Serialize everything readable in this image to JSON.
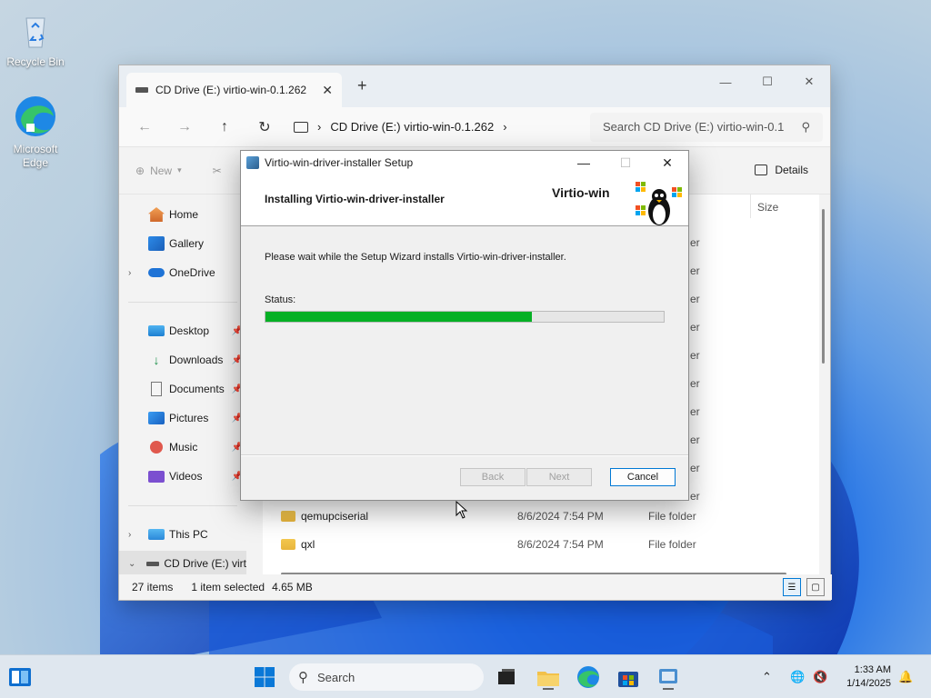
{
  "desktop": {
    "icons": [
      {
        "label": "Recycle Bin"
      },
      {
        "label": "Microsoft Edge"
      }
    ]
  },
  "explorer": {
    "tab_title": "CD Drive (E:) virtio-win-0.1.262",
    "address_path": "CD Drive (E:) virtio-win-0.1.262",
    "search_placeholder": "Search CD Drive (E:) virtio-win-0.1",
    "cmd_new": "New",
    "cmd_details": "Details",
    "column_size": "Size",
    "sidebar": [
      {
        "label": "Home",
        "icon": "home-icon"
      },
      {
        "label": "Gallery",
        "icon": "gallery-icon"
      },
      {
        "label": "OneDrive",
        "icon": "cloud-icon"
      },
      {
        "label": "Desktop",
        "icon": "desktop-icon"
      },
      {
        "label": "Downloads",
        "icon": "download-icon"
      },
      {
        "label": "Documents",
        "icon": "document-icon"
      },
      {
        "label": "Pictures",
        "icon": "pictures-icon"
      },
      {
        "label": "Music",
        "icon": "music-icon"
      },
      {
        "label": "Videos",
        "icon": "video-icon"
      },
      {
        "label": "This PC",
        "icon": "pc-icon"
      },
      {
        "label": "CD Drive (E:) virt",
        "icon": "cd-drive-icon"
      }
    ],
    "partial_column": "er",
    "files": [
      {
        "name": "qemupciserial",
        "date": "8/6/2024 7:54 PM",
        "type": "File folder"
      },
      {
        "name": "qxl",
        "date": "8/6/2024 7:54 PM",
        "type": "File folder"
      }
    ],
    "status": {
      "items": "27 items",
      "selected": "1 item selected",
      "size": "4.65 MB"
    }
  },
  "setup": {
    "window_title": "Virtio-win-driver-installer Setup",
    "header": "Installing Virtio-win-driver-installer",
    "brand": "Virtio-win",
    "message": "Please wait while the Setup Wizard installs Virtio-win-driver-installer.",
    "status_label": "Status:",
    "progress": 0.67,
    "back_label": "Back",
    "next_label": "Next",
    "cancel_label": "Cancel"
  },
  "taskbar": {
    "search_label": "Search",
    "time": "1:33 AM",
    "date": "1/14/2025"
  },
  "colors": {
    "progress_fill": "#06b025",
    "accent": "#0078d4"
  }
}
